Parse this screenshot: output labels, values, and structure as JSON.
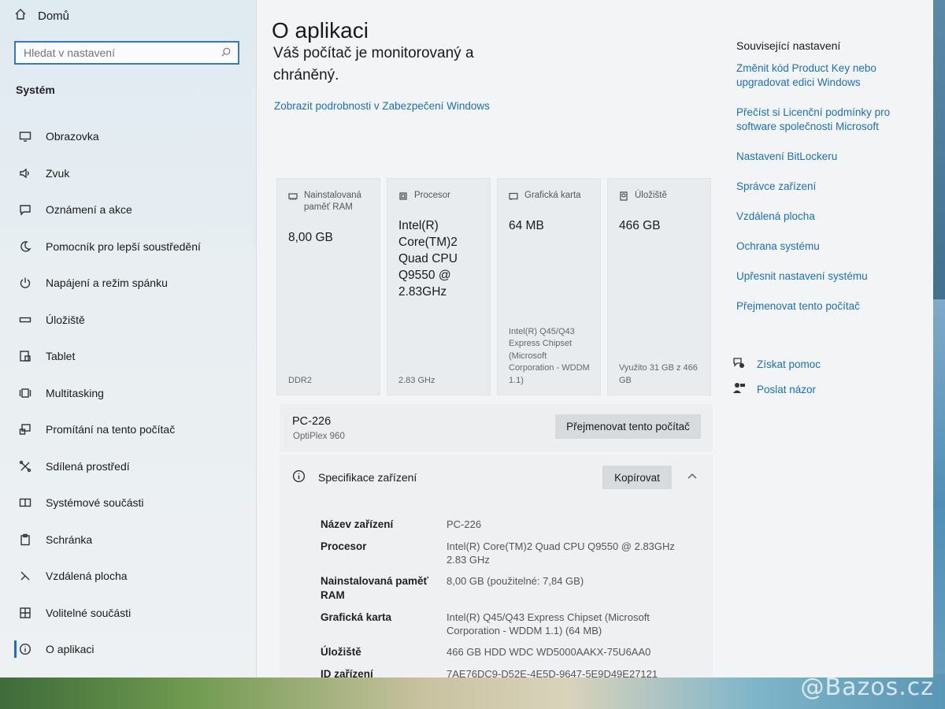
{
  "nav": {
    "home_label": "Domů",
    "search_placeholder": "Hledat v nastavení",
    "section": "Systém",
    "items": [
      {
        "label": "Obrazovka",
        "icon": "display-icon"
      },
      {
        "label": "Zvuk",
        "icon": "speaker-icon"
      },
      {
        "label": "Oznámení a akce",
        "icon": "notification-icon"
      },
      {
        "label": "Pomocník pro lepší soustředění",
        "icon": "moon-icon"
      },
      {
        "label": "Napájení a režim spánku",
        "icon": "power-icon"
      },
      {
        "label": "Úložiště",
        "icon": "storage-icon"
      },
      {
        "label": "Tablet",
        "icon": "tablet-icon"
      },
      {
        "label": "Multitasking",
        "icon": "multitasking-icon"
      },
      {
        "label": "Promítání na tento počítač",
        "icon": "projecting-icon"
      },
      {
        "label": "Sdílená prostředí",
        "icon": "shared-icon"
      },
      {
        "label": "Systémové součásti",
        "icon": "components-icon"
      },
      {
        "label": "Schránka",
        "icon": "clipboard-icon"
      },
      {
        "label": "Vzdálená plocha",
        "icon": "remote-icon"
      },
      {
        "label": "Volitelné součásti",
        "icon": "optional-icon"
      },
      {
        "label": "O aplikaci",
        "icon": "info-icon"
      }
    ]
  },
  "main": {
    "title": "O aplikaci",
    "monitor_text": "Váš počítač je monitorovaný a chráněný.",
    "security_link": "Zobrazit podrobnosti v Zabezpečení Windows",
    "cards": [
      {
        "header": "Nainstalovaná paměť RAM",
        "value": "8,00 GB",
        "sub": "DDR2"
      },
      {
        "header": "Procesor",
        "value": "Intel(R) Core(TM)2 Quad CPU Q9550 @ 2.83GHz",
        "sub": "2.83 GHz"
      },
      {
        "header": "Grafická karta",
        "value": "64 MB",
        "sub": "Intel(R) Q45/Q43 Express Chipset (Microsoft Corporation - WDDM 1.1)"
      },
      {
        "header": "Úložiště",
        "value": "466 GB",
        "sub": "Využito 31 GB z 466 GB"
      }
    ],
    "pc_name": "PC-226",
    "pc_model": "OptiPlex 960",
    "rename_button": "Přejmenovat tento počítač",
    "spec_title": "Specifikace zařízení",
    "copy_button": "Kopírovat",
    "specs": [
      {
        "key": "Název zařízení",
        "value": "PC-226"
      },
      {
        "key": "Procesor",
        "value": "Intel(R) Core(TM)2 Quad CPU Q9550 @ 2.83GHz 2.83 GHz"
      },
      {
        "key": "Nainstalovaná paměť RAM",
        "value": "8,00 GB (použitelné: 7,84 GB)"
      },
      {
        "key": "Grafická karta",
        "value": "Intel(R) Q45/Q43 Express Chipset (Microsoft Corporation - WDDM 1.1) (64 MB)"
      },
      {
        "key": "Úložiště",
        "value": "466 GB HDD WDC WD5000AAKX-75U6AA0"
      },
      {
        "key": "ID zařízení",
        "value": "7AE76DC9-D52E-4E5D-9647-5E9D49E27121"
      }
    ]
  },
  "related": {
    "title": "Související nastavení",
    "links": [
      "Změnit kód Product Key nebo upgradovat edici Windows",
      "Přečíst si Licenční podmínky pro software společnosti Microsoft",
      "Nastavení BitLockeru",
      "Správce zařízení",
      "Vzdálená plocha",
      "Ochrana systému",
      "Upřesnit nastavení systému",
      "Přejmenovat tento počítač"
    ],
    "help": "Získat pomoc",
    "feedback": "Poslat názor"
  },
  "watermark": "@Bazos.cz",
  "colors": {
    "accent": "#1b6fc2",
    "active_bar": "#1e6fbf"
  }
}
